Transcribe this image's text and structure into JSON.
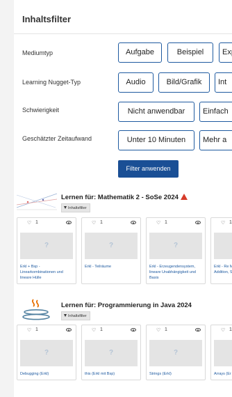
{
  "filter": {
    "title": "Inhaltsfilter",
    "rows": [
      {
        "label": "Mediumtyp",
        "options": [
          "Aufgabe",
          "Beispiel",
          "Exp"
        ]
      },
      {
        "label": "Learning Nugget-Typ",
        "options": [
          "Audio",
          "Bild/Grafik",
          "Int"
        ]
      },
      {
        "label": "Schwierigkeit",
        "options": [
          "Nicht anwendbar",
          "Einfach"
        ]
      },
      {
        "label": "Geschätzter Zeitaufwand",
        "options": [
          "Unter 10 Minuten",
          "Mehr a"
        ]
      }
    ],
    "apply_label": "Filter anwenden"
  },
  "courses": [
    {
      "title": "Lernen für: Mathematik 2 - SoSe 2024",
      "has_warning": true,
      "badge": "Inhaltsfilter",
      "cards": [
        {
          "likes": "1",
          "label": "Erkl + Bsp - Linearkombinationen und lineare Hülle"
        },
        {
          "likes": "1",
          "label": "Erkl - Teilräume"
        },
        {
          "likes": "1",
          "label": "Erkl - Erzeugendensystem, lineare Unabhängigkeit und Basis"
        },
        {
          "likes": "1",
          "label": "Erkl - Re Matrizen (Matrizen Addition, Skalarm"
        }
      ]
    },
    {
      "title": "Lernen für: Programmierung in Java 2024",
      "has_warning": false,
      "badge": "Inhaltsfilter",
      "cards": [
        {
          "likes": "1",
          "label": "Debugging (Erkl)"
        },
        {
          "likes": "1",
          "label": "this (Erkl mit Bsp)"
        },
        {
          "likes": "1",
          "label": "Strings (Erkl)"
        },
        {
          "likes": "1",
          "label": "Arrays (Er"
        }
      ]
    }
  ],
  "colors": {
    "accent": "#1a4f95",
    "chip_border": "#1e5aa0",
    "warning": "#d63b2a",
    "link": "#1e5aa0"
  },
  "icons": {
    "like": "heart-icon",
    "views": "eye-icon",
    "placeholder": "question-mark-icon",
    "filter": "filter-icon",
    "warning": "warning-icon"
  }
}
